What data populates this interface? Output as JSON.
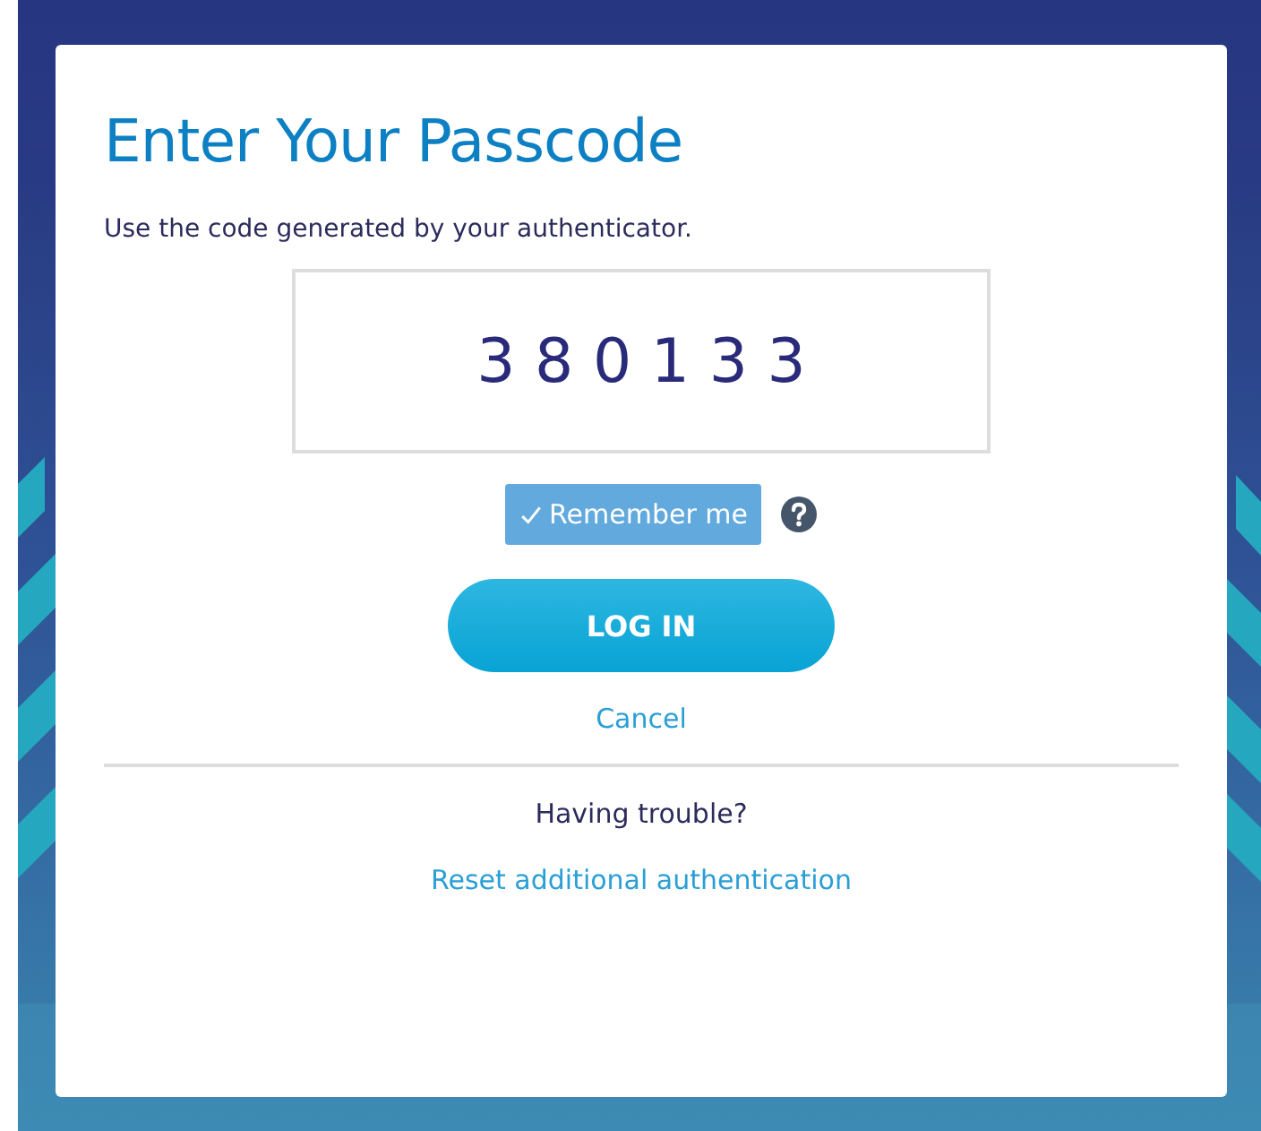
{
  "title": "Enter Your Passcode",
  "instruction": "Use the code generated by your authenticator.",
  "passcode": {
    "value": "3 8 0 1 3 3"
  },
  "remember_me": {
    "label": "Remember me",
    "checked": true
  },
  "login_button": "LOG IN",
  "cancel_link": "Cancel",
  "trouble_text": "Having trouble?",
  "reset_link": "Reset additional authentication"
}
